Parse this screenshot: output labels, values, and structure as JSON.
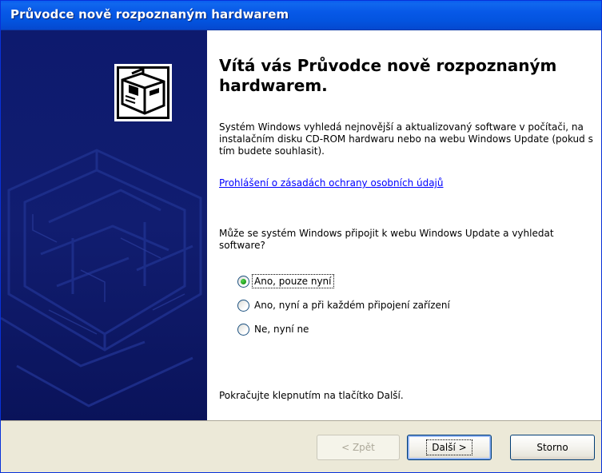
{
  "window": {
    "title": "Průvodce nově rozpoznaným hardwarem"
  },
  "content": {
    "heading": "Vítá vás Průvodce nově rozpoznaným hardwarem.",
    "intro": "Systém Windows vyhledá nejnovější a aktualizovaný software v počítači, na instalačním disku CD-ROM hardwaru nebo na webu Windows Update (pokud s tím budete souhlasit).",
    "privacy_link": "Prohlášení o zásadách ochrany osobních údajů",
    "question": "Může se systém Windows připojit k webu Windows Update a vyhledat software?",
    "options": [
      {
        "label": "Ano, pouze nyní",
        "checked": true
      },
      {
        "label": "Ano, nyní a při každém připojení zařízení",
        "checked": false
      },
      {
        "label": "Ne, nyní ne",
        "checked": false
      }
    ],
    "continue_text": "Pokračujte klepnutím na tlačítko Další."
  },
  "buttons": {
    "back": "< Zpět",
    "next": "Další >",
    "cancel": "Storno"
  },
  "icons": {
    "left_panel": "hardware-icon"
  },
  "colors": {
    "titlebar": "#0758e7",
    "left_panel": "#101a66",
    "link": "#0000ff",
    "dialog_face": "#ece9d8"
  }
}
